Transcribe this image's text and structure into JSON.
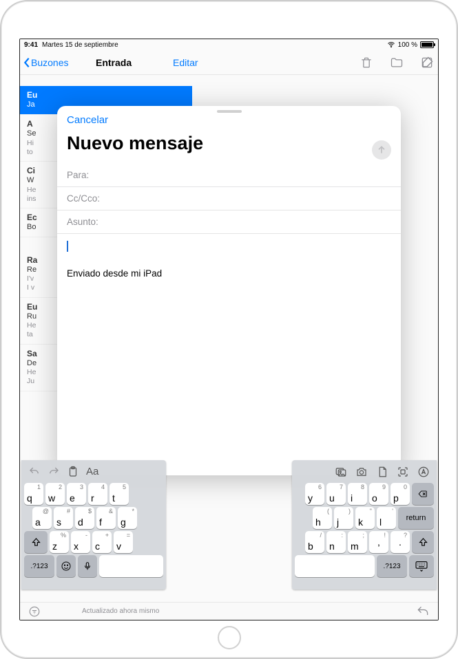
{
  "status": {
    "time": "9:41",
    "date": "Martes 15 de septiembre",
    "battery_text": "100 %"
  },
  "mail_nav": {
    "back": "Buzones",
    "title": "Entrada",
    "edit": "Editar"
  },
  "mail_list": [
    {
      "sender": "Eu",
      "subj": "Ja",
      "prev": ""
    },
    {
      "sender": "A",
      "subj": "Se",
      "prev": "Hi\nto"
    },
    {
      "sender": "Ci",
      "subj": "W",
      "prev": "He\nins"
    },
    {
      "sender": "Ec",
      "subj": "Bo",
      "prev": ""
    },
    {
      "sender": "Ra",
      "subj": "Re",
      "prev": "I'v\nI v"
    },
    {
      "sender": "Eu",
      "subj": "Ru",
      "prev": "He\nta"
    },
    {
      "sender": "Sa",
      "subj": "De",
      "prev": "He\nJu"
    }
  ],
  "mail_footer": {
    "updated": "Actualizado ahora mismo"
  },
  "compose": {
    "cancel": "Cancelar",
    "title": "Nuevo mensaje",
    "to_label": "Para:",
    "cc_label": "Cc/Cco:",
    "subject_label": "Asunto:",
    "signature": "Enviado desde mi iPad"
  },
  "keyboard": {
    "left": {
      "row1": [
        "q",
        "w",
        "e",
        "r",
        "t"
      ],
      "row2": [
        "a",
        "s",
        "d",
        "f",
        "g"
      ],
      "row3": [
        "z",
        "x",
        "c",
        "v"
      ],
      "numkey": ".?123",
      "fmt_label": "Aa"
    },
    "right": {
      "row1": [
        "y",
        "u",
        "i",
        "o",
        "p"
      ],
      "row2": [
        "h",
        "j",
        "k",
        "l"
      ],
      "row3": [
        "b",
        "n",
        "m"
      ],
      "row3_punct": [
        "!",
        ",",
        "?",
        "."
      ],
      "return": "return",
      "numkey": ".?123"
    }
  }
}
